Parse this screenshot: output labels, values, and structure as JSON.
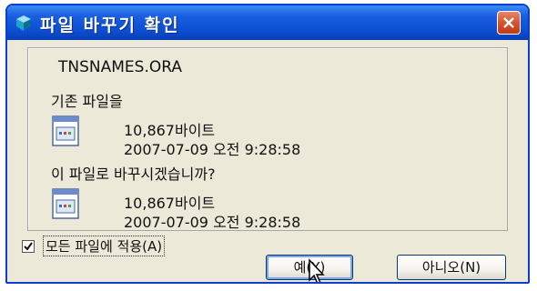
{
  "dialog": {
    "title": "파일 바꾸기 확인",
    "filename": "TNSNAMES.ORA",
    "existing_label": "기존 파일을",
    "existing_file": {
      "size": "10,867바이트",
      "modified": "2007-07-09 오전 9:28:58"
    },
    "replace_prompt": "이 파일로 바꾸시겠습니까?",
    "new_file": {
      "size": "10,867바이트",
      "modified": "2007-07-09 오전 9:28:58"
    },
    "apply_all_label": "모든 파일에 적용(A)",
    "apply_all_checked": true,
    "yes_button": "예(Y)",
    "no_button": "아니오(N)"
  },
  "colors": {
    "titlebar": "#0d4fd4",
    "close_button": "#d9532c",
    "dialog_background": "#ece9d8"
  },
  "icons": {
    "title": "window-icon",
    "close": "close-icon",
    "file": "text-file-icon",
    "cursor": "mouse-pointer-icon"
  }
}
